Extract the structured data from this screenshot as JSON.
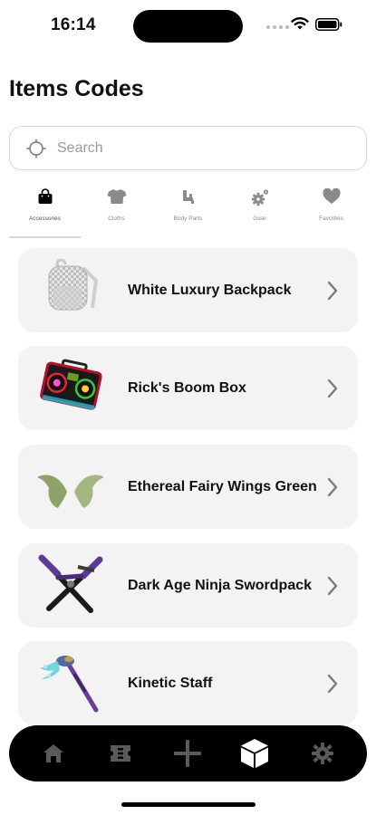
{
  "status_bar": {
    "time": "16:14"
  },
  "header": {
    "title": "Items Codes"
  },
  "search": {
    "placeholder": "Search",
    "value": ""
  },
  "tabs": [
    {
      "label": "Accessories",
      "icon": "bag-icon",
      "active": true
    },
    {
      "label": "Cloths",
      "icon": "shirt-icon",
      "active": false
    },
    {
      "label": "Body Parts",
      "icon": "body-parts-icon",
      "active": false
    },
    {
      "label": "Gear",
      "icon": "gear-icon",
      "active": false
    },
    {
      "label": "Favorites",
      "icon": "heart-icon",
      "active": false
    }
  ],
  "items": [
    {
      "name": "White Luxury Backpack",
      "image": "backpack-image"
    },
    {
      "name": "Rick's Boom Box",
      "image": "boombox-image"
    },
    {
      "name": "Ethereal Fairy Wings Green",
      "image": "fairy-wings-image"
    },
    {
      "name": "Dark Age Ninja Swordpack",
      "image": "swordpack-image"
    },
    {
      "name": "Kinetic Staff",
      "image": "staff-image"
    }
  ],
  "bottom_nav": [
    {
      "icon": "home-icon",
      "active": false
    },
    {
      "icon": "ticket-icon",
      "active": false
    },
    {
      "icon": "plus-icon",
      "active": false
    },
    {
      "icon": "box-icon",
      "active": true
    },
    {
      "icon": "settings-icon",
      "active": false
    }
  ],
  "colors": {
    "background": "#ffffff",
    "card": "#f3f3f3",
    "nav_bar": "#000000",
    "nav_active": "#ffffff",
    "nav_inactive": "#5a5a5a"
  }
}
